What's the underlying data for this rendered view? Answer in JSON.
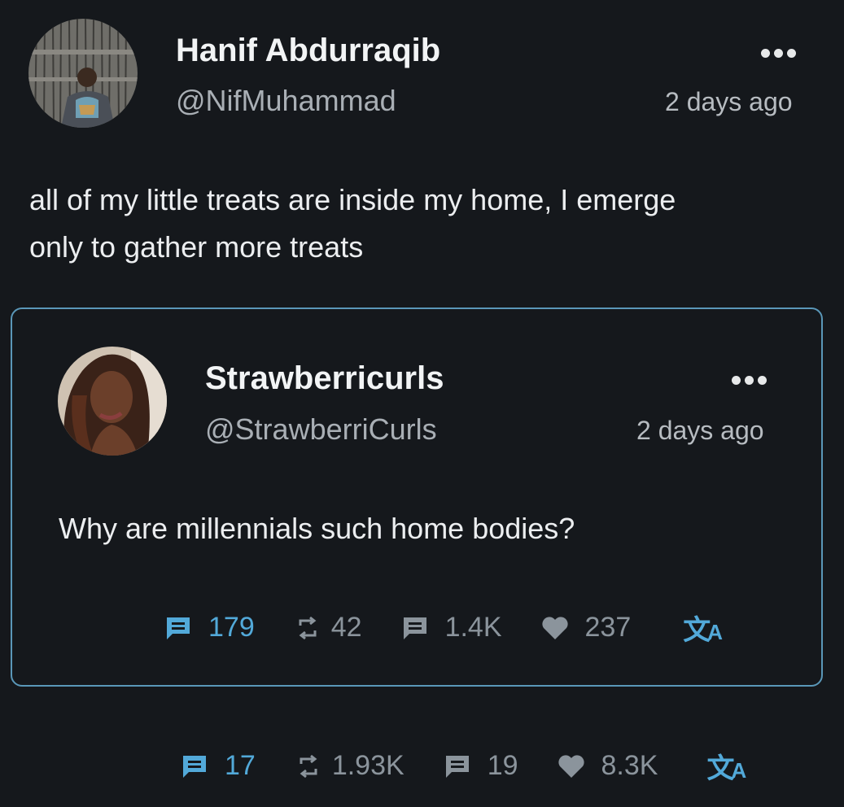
{
  "post": {
    "author_name": "Hanif Abdurraqib",
    "author_handle": "@NifMuhammad",
    "timestamp": "2 days ago",
    "text_line1": "all of my little treats are inside my home, I emerge",
    "text_line2": "only to gather more treats",
    "stats": {
      "comments": "17",
      "reposts": "1.93K",
      "quotes": "19",
      "likes": "8.3K"
    }
  },
  "quoted_post": {
    "author_name": "Strawberricurls",
    "author_handle": "@StrawberriCurls",
    "timestamp": "2 days ago",
    "text": "Why are millennials such home bodies?",
    "stats": {
      "comments": "179",
      "reposts": "42",
      "quotes": "1.4K",
      "likes": "237"
    }
  },
  "icons": {
    "comment": "comment-icon",
    "repost": "repost-icon",
    "quote": "quote-icon",
    "like": "heart-icon",
    "translate": "translate-icon",
    "more": "more-dots-icon"
  },
  "colors": {
    "background": "#15181c",
    "accent": "#52a9d9",
    "muted": "#8b949c",
    "quote_border": "#5a97b8"
  }
}
